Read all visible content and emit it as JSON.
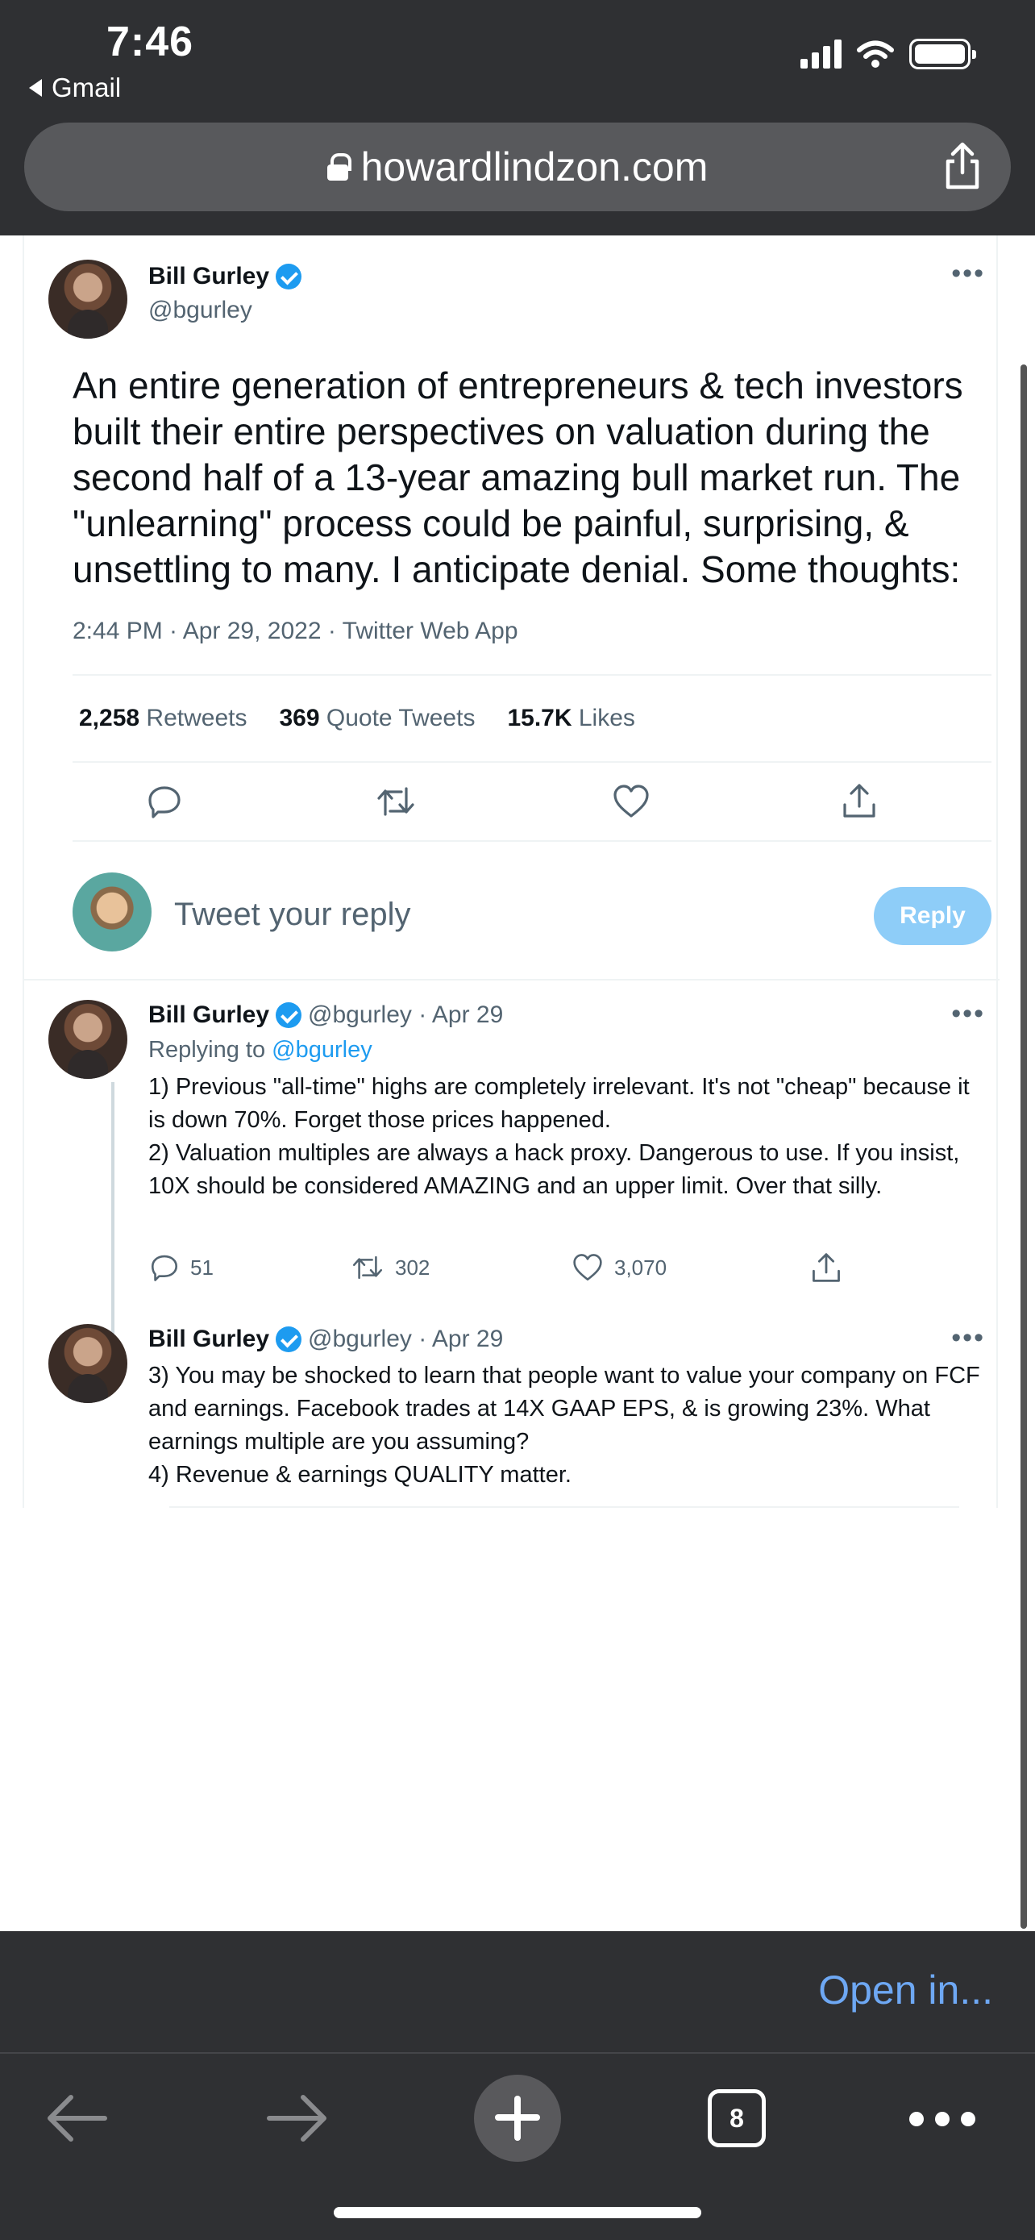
{
  "status": {
    "time": "7:46",
    "back_app": "Gmail"
  },
  "browser": {
    "url": "howardlindzon.com",
    "open_in": "Open in...",
    "tab_count": "8"
  },
  "tweet": {
    "author": "Bill Gurley",
    "handle": "@bgurley",
    "text": "An entire generation of entrepreneurs & tech investors built their entire perspectives on valuation during the second  half of a 13-year amazing bull market run. The \"unlearning\" process could be painful, surprising, & unsettling to many. I anticipate denial. Some thoughts:",
    "meta": "2:44 PM · Apr 29, 2022 · Twitter Web App",
    "retweets_count": "2,258",
    "retweets_label": "Retweets",
    "quotes_count": "369",
    "quotes_label": "Quote Tweets",
    "likes_count": "15.7K",
    "likes_label": "Likes"
  },
  "reply_box": {
    "placeholder": "Tweet your reply",
    "button": "Reply"
  },
  "replies": [
    {
      "author": "Bill Gurley",
      "handle_date": "@bgurley · Apr 29",
      "replying_prefix": "Replying to",
      "replying_to": "@bgurley",
      "text1": "1) Previous \"all-time\" highs are completely irrelevant. It's not \"cheap\" because it is down 70%. Forget those prices happened.",
      "text2": "2) Valuation multiples are always a hack proxy. Dangerous to use. If you insist, 10X should be considered AMAZING and an upper limit. Over that silly.",
      "replies": "51",
      "retweets": "302",
      "likes": "3,070"
    },
    {
      "author": "Bill Gurley",
      "handle_date": "@bgurley · Apr 29",
      "text1": "3) You may be shocked to learn that people want to value your company on FCF and earnings. Facebook trades at 14X GAAP EPS, & is growing 23%. What earnings multiple are you assuming?",
      "text2": "4) Revenue & earnings QUALITY matter."
    }
  ],
  "colors": {
    "accent": "#1d9bf0",
    "reply_button": "#8ecdf8",
    "chrome": "#2f3033",
    "open_in": "#6ea8f4"
  },
  "icons": [
    "lock-icon",
    "share-icon",
    "more-icon",
    "verified-icon",
    "reply-icon",
    "retweet-icon",
    "like-icon",
    "share-tweet-icon",
    "back-arrow-icon",
    "forward-arrow-icon",
    "new-tab-icon",
    "tabs-icon"
  ]
}
